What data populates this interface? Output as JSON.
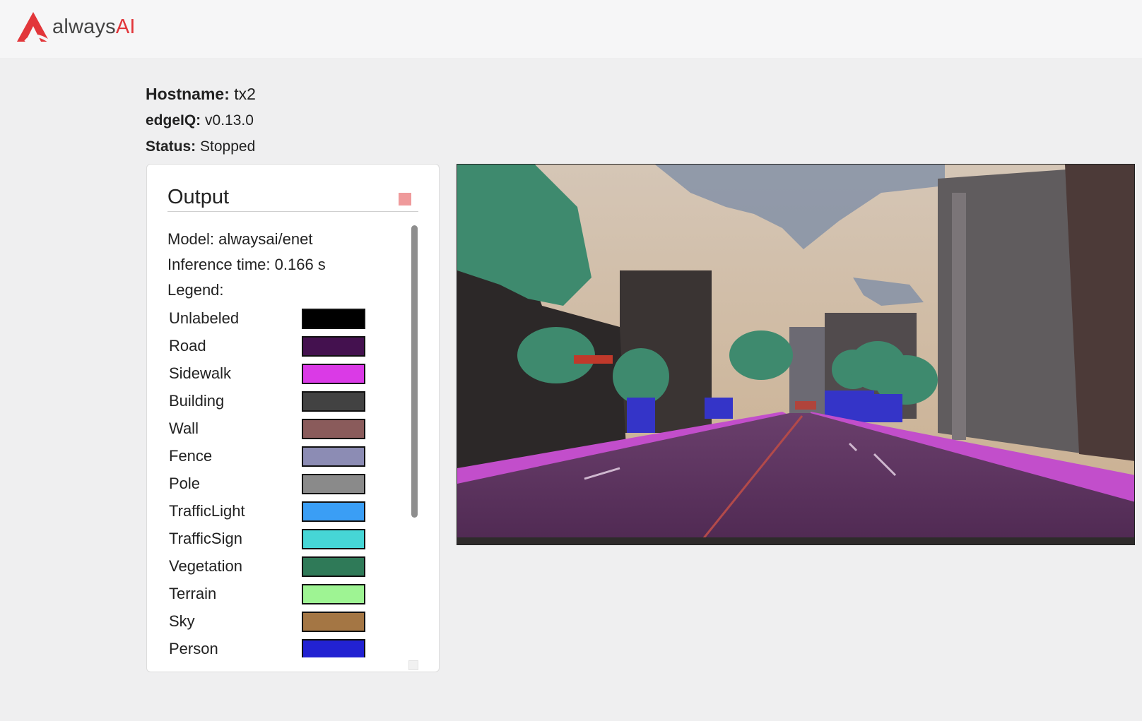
{
  "brand": {
    "name_prefix": "always",
    "name_suffix": "AI",
    "accent_color": "#e2363a"
  },
  "info": {
    "hostname_label": "Hostname:",
    "hostname_value": "tx2",
    "edgeiq_label": "edgeIQ:",
    "edgeiq_value": "v0.13.0",
    "status_label": "Status:",
    "status_value": "Stopped"
  },
  "output": {
    "title": "Output",
    "stop_icon": "square-stop-icon",
    "model_line": "Model: alwaysai/enet",
    "inference_line": "Inference time: 0.166 s",
    "legend_heading": "Legend:",
    "legend": [
      {
        "label": "Unlabeled",
        "color": "#000000"
      },
      {
        "label": "Road",
        "color": "#44114f"
      },
      {
        "label": "Sidewalk",
        "color": "#da3ae6"
      },
      {
        "label": "Building",
        "color": "#424242"
      },
      {
        "label": "Wall",
        "color": "#8a5b5b"
      },
      {
        "label": "Fence",
        "color": "#8c8cb4"
      },
      {
        "label": "Pole",
        "color": "#8a8a8a"
      },
      {
        "label": "TrafficLight",
        "color": "#3a9ef5"
      },
      {
        "label": "TrafficSign",
        "color": "#46d6d6"
      },
      {
        "label": "Vegetation",
        "color": "#2f7a58"
      },
      {
        "label": "Terrain",
        "color": "#9ef493"
      },
      {
        "label": "Sky",
        "color": "#a47644"
      },
      {
        "label": "Person",
        "color": "#2222d2"
      }
    ]
  },
  "video": {
    "content": "segmented-street-scene-image"
  }
}
